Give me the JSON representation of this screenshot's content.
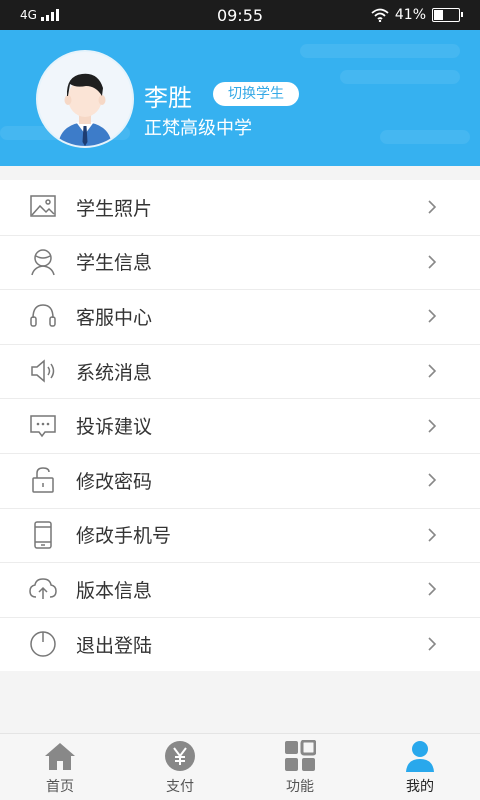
{
  "status_bar": {
    "network": "4G",
    "time": "09:55",
    "battery": "41%",
    "battery_level": 0.41
  },
  "profile": {
    "name": "李胜",
    "switch_label": "切换学生",
    "school": "正梵高级中学"
  },
  "menu": [
    {
      "label": "学生照片",
      "icon": "photo-icon"
    },
    {
      "label": "学生信息",
      "icon": "person-icon"
    },
    {
      "label": "客服中心",
      "icon": "headset-icon"
    },
    {
      "label": "系统消息",
      "icon": "speaker-icon"
    },
    {
      "label": "投诉建议",
      "icon": "message-icon"
    },
    {
      "label": "修改密码",
      "icon": "lock-icon"
    },
    {
      "label": "修改手机号",
      "icon": "phone-icon"
    },
    {
      "label": "版本信息",
      "icon": "cloud-upload-icon"
    },
    {
      "label": "退出登陆",
      "icon": "power-icon"
    }
  ],
  "tabbar": [
    {
      "label": "首页",
      "icon": "home-icon",
      "active": false
    },
    {
      "label": "支付",
      "icon": "yen-icon",
      "active": false
    },
    {
      "label": "功能",
      "icon": "grid-icon",
      "active": false
    },
    {
      "label": "我的",
      "icon": "user-icon",
      "active": true
    }
  ],
  "colors": {
    "accent": "#36b1f0",
    "active_tab": "#29a8ec",
    "icon_gray": "#777777"
  }
}
